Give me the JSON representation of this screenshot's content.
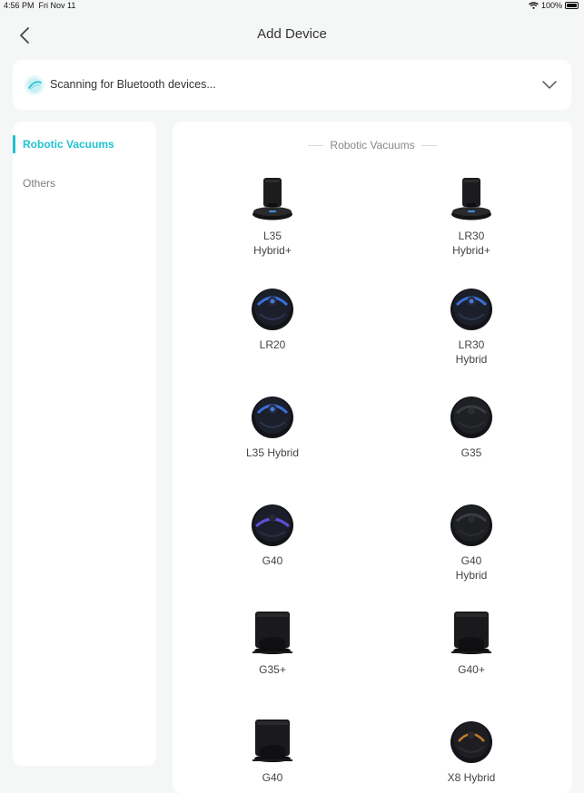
{
  "status_bar": {
    "time": "4:56 PM",
    "date": "Fri Nov 11",
    "battery": "100%"
  },
  "nav": {
    "title": "Add Device",
    "back_icon": "chevron-left-icon"
  },
  "scan": {
    "text": "Scanning for Bluetooth devices...",
    "icon": "bluetooth-scan-icon",
    "expand_icon": "chevron-down-icon"
  },
  "sidebar": {
    "items": [
      {
        "label": "Robotic Vacuums",
        "active": true
      },
      {
        "label": "Others",
        "active": false
      }
    ]
  },
  "main": {
    "section_title": "Robotic Vacuums",
    "devices": [
      {
        "name": "L35\nHybrid+",
        "icon": "station-robot-icon"
      },
      {
        "name": "LR30\nHybrid+",
        "icon": "station-robot-icon"
      },
      {
        "name": "LR20",
        "icon": "robot-vacuum-icon"
      },
      {
        "name": "LR30\nHybrid",
        "icon": "robot-vacuum-icon"
      },
      {
        "name": "L35 Hybrid",
        "icon": "robot-vacuum-icon"
      },
      {
        "name": "G35",
        "icon": "robot-vacuum-icon"
      },
      {
        "name": "G40",
        "icon": "robot-vacuum-icon"
      },
      {
        "name": "G40\nHybrid",
        "icon": "robot-vacuum-icon"
      },
      {
        "name": "G35+",
        "icon": "dock-station-icon"
      },
      {
        "name": "G40+",
        "icon": "dock-station-icon"
      },
      {
        "name": "G40",
        "icon": "dock-station-icon"
      },
      {
        "name": "X8 Hybrid",
        "icon": "robot-vacuum-icon"
      }
    ]
  },
  "colors": {
    "accent": "#20c3d0",
    "background": "#f5f6f6",
    "card": "#ffffff"
  }
}
